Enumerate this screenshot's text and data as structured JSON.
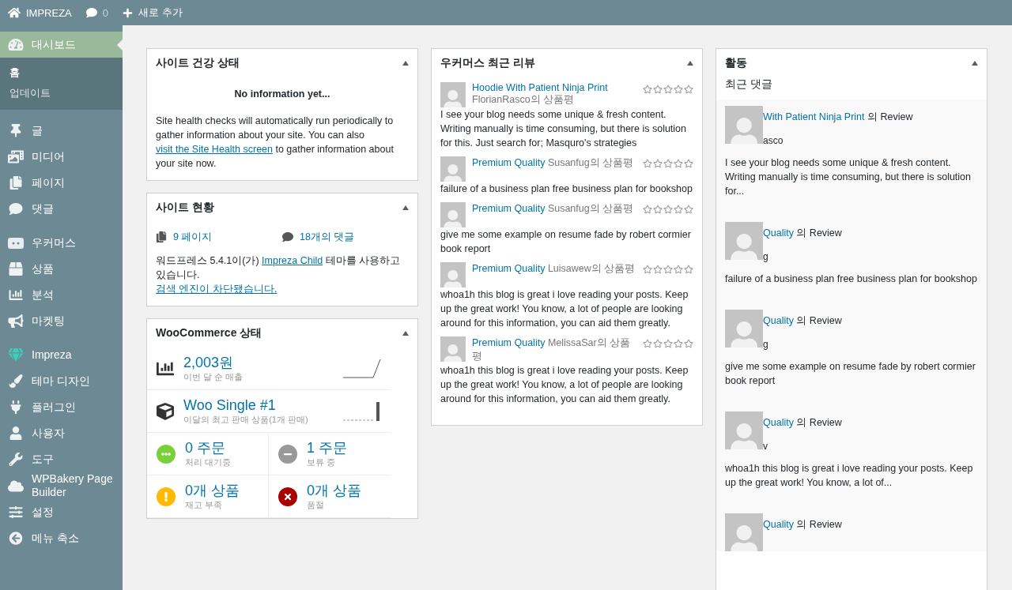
{
  "admin_bar": {
    "site_name": "IMPREZA",
    "comments_count": "0",
    "new_label": "새로 추가"
  },
  "sidebar": {
    "groups": [
      [
        {
          "label": "대시보드",
          "selected": true,
          "children": [
            {
              "label": "홈",
              "selected": true
            },
            {
              "label": "업데이트",
              "selected": false
            }
          ]
        }
      ],
      [
        {
          "label": "글",
          "selected": false
        },
        {
          "label": "미디어",
          "selected": false
        },
        {
          "label": "페이지",
          "selected": false
        },
        {
          "label": "댓글",
          "selected": false
        }
      ],
      [
        {
          "label": "우커머스",
          "selected": false
        },
        {
          "label": "상품",
          "selected": false
        },
        {
          "label": "분석",
          "selected": false
        },
        {
          "label": "마켓팅",
          "selected": false
        }
      ],
      [
        {
          "label": "Impreza",
          "selected": false
        },
        {
          "label": "테마 디자인",
          "selected": false
        },
        {
          "label": "플러그인",
          "selected": false
        },
        {
          "label": "사용자",
          "selected": false
        },
        {
          "label": "도구",
          "selected": false
        },
        {
          "label": "WPBakery Page Builder",
          "selected": false
        },
        {
          "label": "설정",
          "selected": false
        },
        {
          "label": "메뉴 축소",
          "selected": false
        }
      ]
    ]
  },
  "site_health": {
    "title": "사이트 건강 상태",
    "status": "No information yet...",
    "text": "Site health checks will automatically run periodically to gather information about your site. You can also ",
    "link": "visit the Site Health screen",
    "text_after": " to gather information about your site now."
  },
  "at_a_glance": {
    "title": "사이트 현황",
    "pages": "9 페이지",
    "comments": "18개의 댓글",
    "text": "워드프레스 5.4.1이(가) ",
    "theme_link": "Impreza Child",
    "text_after": " 테마를 사용하고 있습니다.",
    "search_link": "검색 엔진이 차단됐습니다."
  },
  "woo_status": {
    "title": "WooCommerce 상태",
    "sales": {
      "value": "2,003원",
      "label": "이번 달 순 매출"
    },
    "top_seller": {
      "value": "Woo Single #1",
      "label": "이달의 최고 판매 상품(1개 판매)"
    },
    "tiles": [
      {
        "kind": "processing",
        "value": "0 주문",
        "label": "처리 대기중"
      },
      {
        "kind": "on-hold",
        "value": "1 주문",
        "label": "보류 중"
      },
      {
        "kind": "low-stock",
        "value": "0개 상품",
        "label": "재고 부족"
      },
      {
        "kind": "out-of-stock",
        "value": "0개 상품",
        "label": "품절"
      }
    ]
  },
  "reviews": {
    "title": "우커머스 최근 리뷰",
    "items": [
      {
        "product": "Hoodie With Patient Ninja Print",
        "byline": "FlorianRasco의 상품평",
        "stars": 0,
        "text": "I see your blog needs some unique & fresh content. Writing manually is time consuming, but there is solution for this. Just search for; Masquro's strategies"
      },
      {
        "product": "Premium Quality",
        "byline": "Susanfug의 상품평",
        "stars": 0,
        "text": "failure of a business plan free business plan for bookshop"
      },
      {
        "product": "Premium Quality",
        "byline": "Susanfug의 상품평",
        "stars": 0,
        "text": "give me some example on resume fade by robert cormier book report"
      },
      {
        "product": "Premium Quality",
        "byline": "Luisawew의 상품평",
        "stars": 0,
        "text": "whoa1h this blog is great i love reading your posts. Keep up the great work! You know, a lot of people are looking around for this information, you can aid them greatly."
      },
      {
        "product": "Premium Quality",
        "byline": "MelissaSar의 상품평",
        "stars": 0,
        "text": "whoa1h this blog is great i love reading your posts. Keep up the great work! You know, a lot of people are looking around for this information, you can aid them greatly."
      }
    ]
  },
  "activity": {
    "title": "활동",
    "subtitle": "최근 댓글",
    "items": [
      {
        "link": "With Patient Ninja Print",
        "suffix": "의 Review",
        "author": "asco",
        "text": "I see your blog needs some unique & fresh content. Writing manually is time consuming, but there is solution for..."
      },
      {
        "link": "Quality",
        "suffix": "의 Review",
        "author": "g",
        "text": "failure of a business plan free business plan for bookshop"
      },
      {
        "link": "Quality",
        "suffix": "의 Review",
        "author": "g",
        "text": "give me some example on resume fade by robert cormier book report"
      },
      {
        "link": "Quality",
        "suffix": "의 Review",
        "author": "v",
        "text": "whoa1h this blog is great i love reading your posts. Keep up the great work! You know, a lot of..."
      },
      {
        "link": "Quality",
        "suffix": "의 Review"
      }
    ]
  }
}
